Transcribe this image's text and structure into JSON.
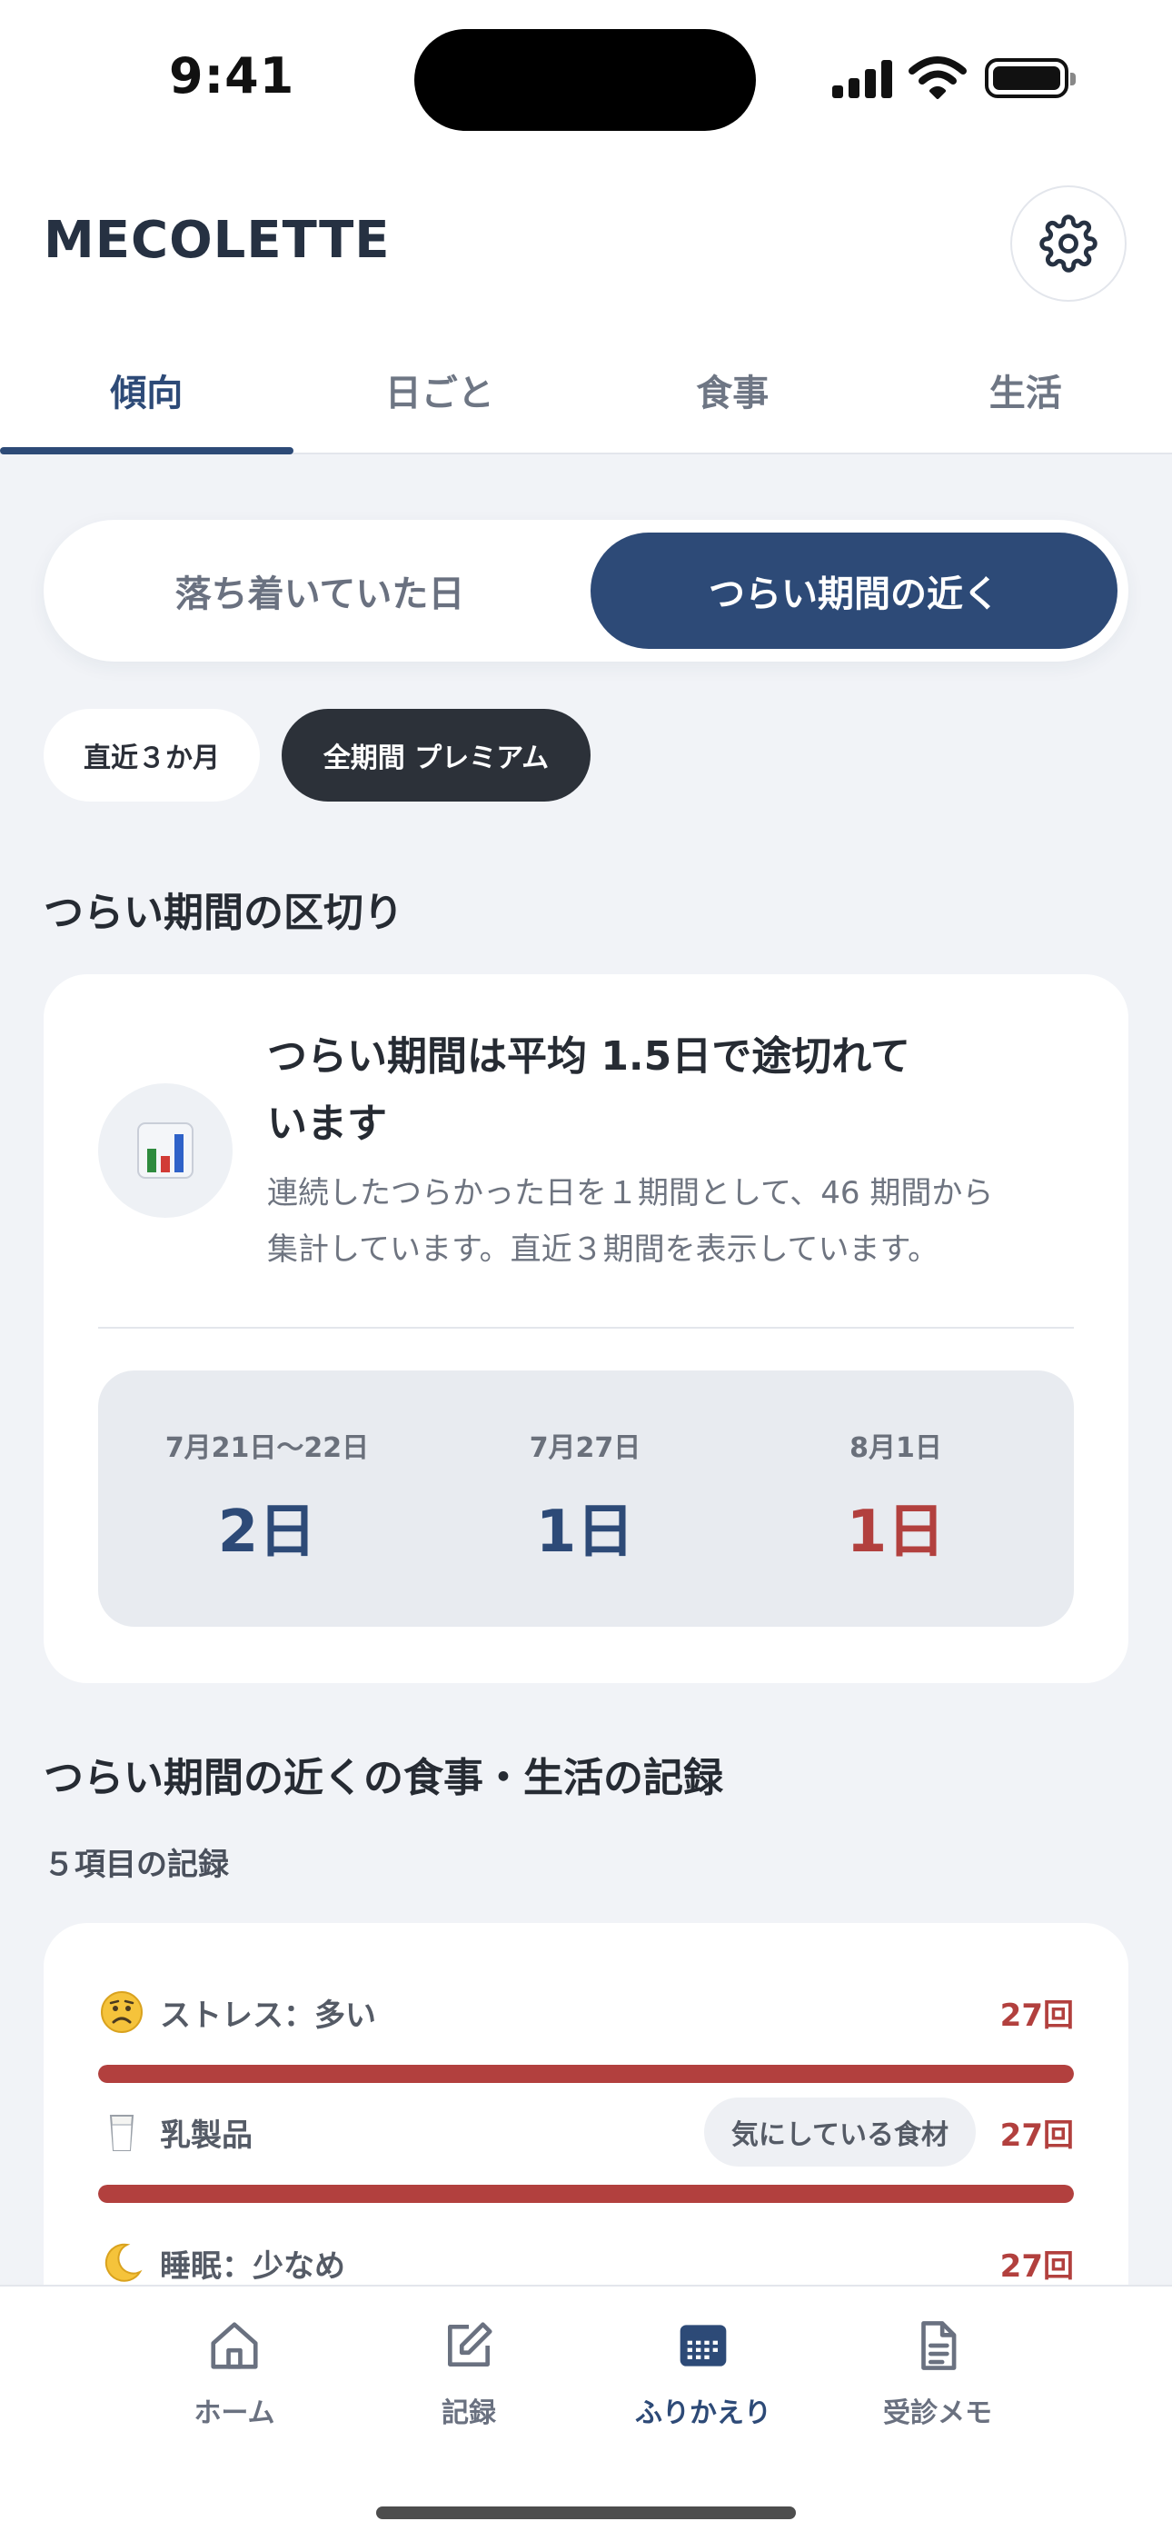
{
  "status": {
    "time": "9:41"
  },
  "header": {
    "logo": "MECOLETTE"
  },
  "tabs": [
    {
      "label": "傾向",
      "active": true
    },
    {
      "label": "日ごと",
      "active": false
    },
    {
      "label": "食事",
      "active": false
    },
    {
      "label": "生活",
      "active": false
    }
  ],
  "segment": {
    "left": "落ち着いていた日",
    "right": "つらい期間の近く",
    "selected": "right"
  },
  "chips": {
    "recent": "直近３か月",
    "all": "全期間 プレミアム",
    "selected": "all"
  },
  "section1": {
    "title": "つらい期間の区切り",
    "card_title": "つらい期間は平均 1.5日で途切れています",
    "card_title_line1": "つらい期間は平均 1.5日で途切れて",
    "card_title_line2": "います",
    "description_line1": "連続したつらかった日を１期間として、46 期間から",
    "description_line2": "集計しています。直近３期間を表示しています。",
    "periods": [
      {
        "label": "7月21日〜22日",
        "value": "2日",
        "color": "#2D4A77"
      },
      {
        "label": "7月27日",
        "value": "1日",
        "color": "#2D4A77"
      },
      {
        "label": "8月1日",
        "value": "1日",
        "color": "#B2403E"
      }
    ]
  },
  "section2": {
    "title": "つらい期間の近くの食事・生活の記録",
    "subtitle": "５項目の記録",
    "records": [
      {
        "icon": "worried-face-icon",
        "label": "ストレス：多い",
        "count": "27回",
        "badge": "",
        "fill": 1.0
      },
      {
        "icon": "milk-glass-icon",
        "label": "乳製品",
        "count": "27回",
        "badge": "気にしている食材",
        "fill": 1.0
      },
      {
        "icon": "moon-icon",
        "label": "睡眠：少なめ",
        "count": "27回",
        "badge": "",
        "fill": 1.0
      }
    ]
  },
  "bottom_nav": [
    {
      "label": "ホーム",
      "icon": "home-icon",
      "active": false
    },
    {
      "label": "記録",
      "icon": "edit-icon",
      "active": false
    },
    {
      "label": "ふりかえり",
      "icon": "calendar-icon",
      "active": true
    },
    {
      "label": "受診メモ",
      "icon": "document-icon",
      "active": false
    }
  ],
  "colors": {
    "accent": "#2D4A77",
    "danger": "#B2403E",
    "background": "#F1F3F7"
  }
}
